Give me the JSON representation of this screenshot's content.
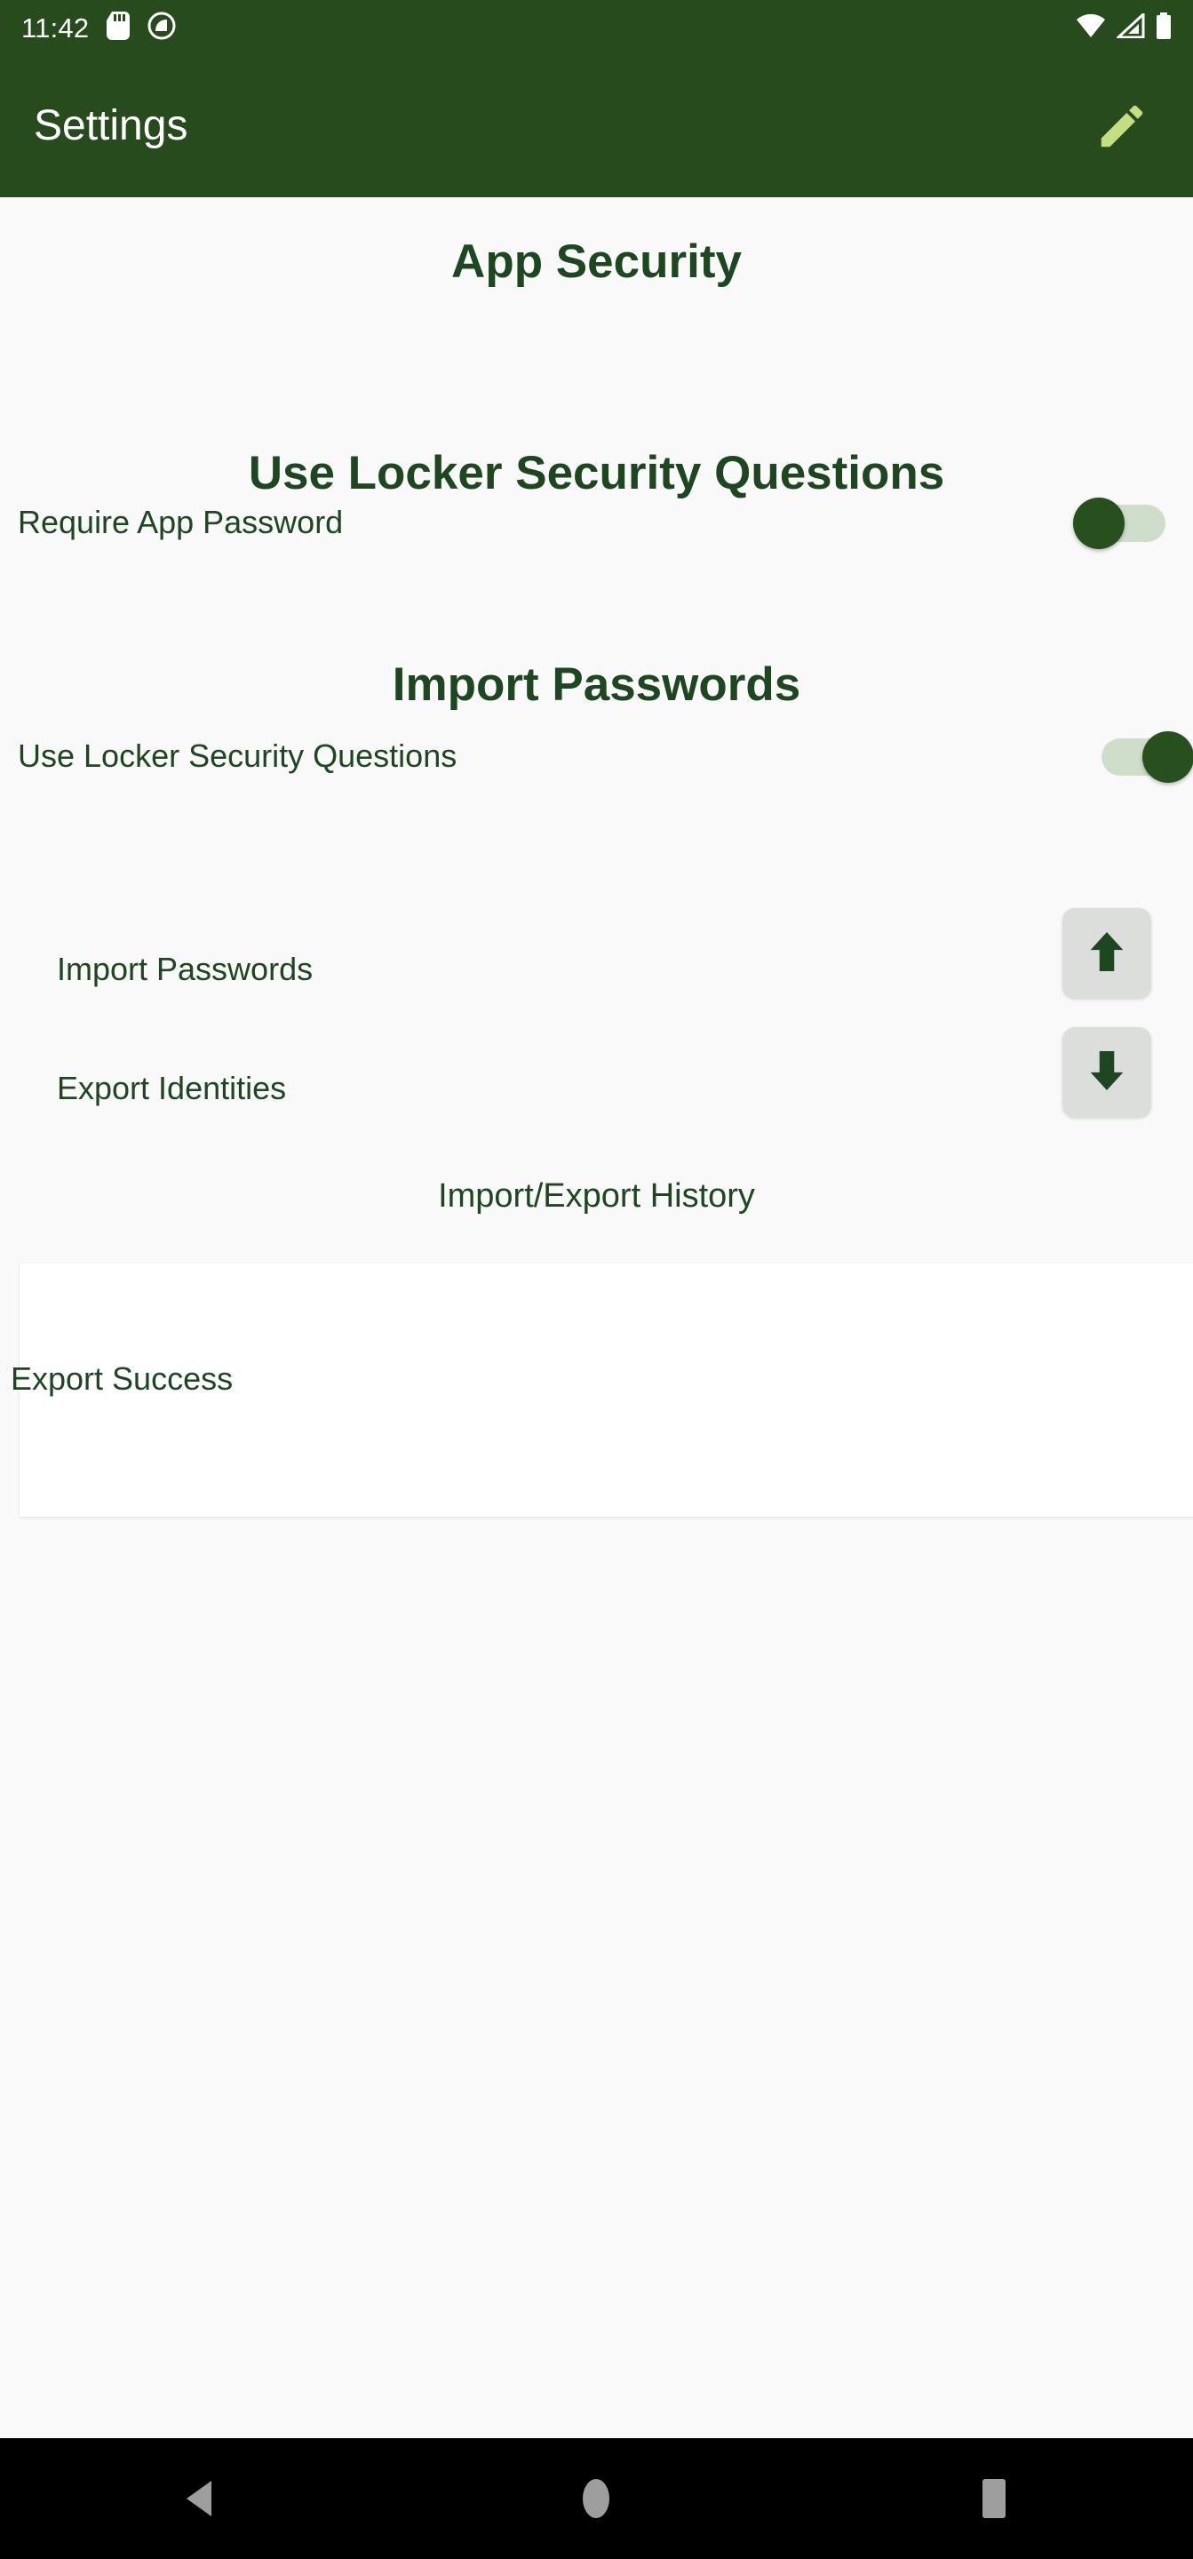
{
  "status_bar": {
    "time": "11:42",
    "icons_left": [
      "sd-card-icon",
      "do-not-disturb-icon"
    ],
    "icons_right": [
      "wifi-icon",
      "cellular-signal-icon",
      "battery-icon"
    ]
  },
  "app_bar": {
    "title": "Settings",
    "action_icon": "edit-pencil-icon"
  },
  "sections": {
    "app_security": {
      "heading": "App Security",
      "row_label": "Require App Password",
      "toggle_state": "off"
    },
    "locker_questions": {
      "heading": "Use Locker Security Questions",
      "row_label": "Use Locker Security Questions",
      "toggle_state": "on"
    },
    "import_passwords": {
      "heading": "Import Passwords",
      "import_label": "Import Passwords",
      "import_icon": "arrow-up-icon",
      "export_label": "Export Identities",
      "export_icon": "arrow-down-icon"
    },
    "history": {
      "heading": "Import/Export History",
      "items": [
        {
          "text": "Export Success"
        }
      ]
    }
  },
  "nav_bar": {
    "back_label": "back-triangle-icon",
    "home_label": "home-circle-icon",
    "recents_label": "recents-square-icon"
  },
  "colors": {
    "primary_green": "#274B1C",
    "text_green": "#1E4620",
    "accent_pencil": "#C3DE83",
    "page_background": "#F8F9F8",
    "card_background": "#FFFFFF",
    "button_background": "#DCDEDC",
    "switch_thumb": "#28501E",
    "switch_track": "#CFDECB"
  }
}
